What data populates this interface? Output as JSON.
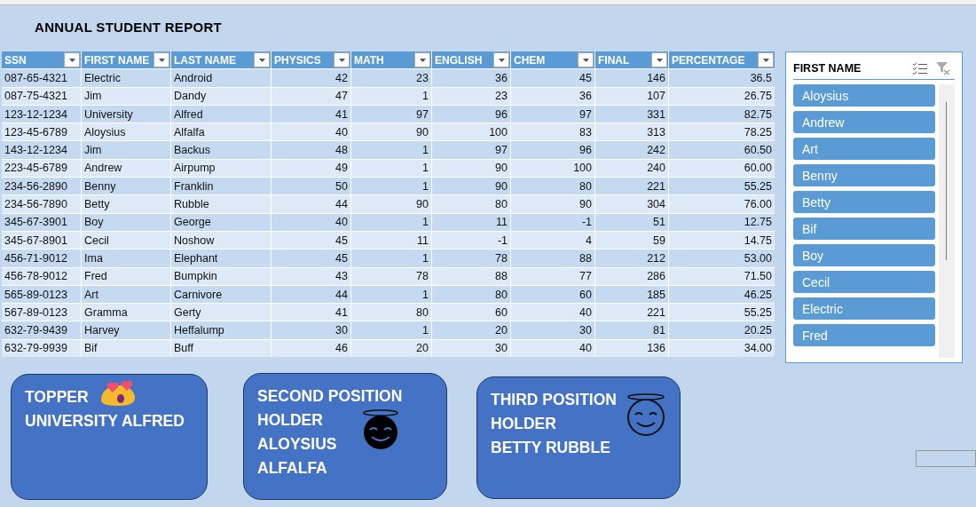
{
  "title": "ANNUAL STUDENT REPORT",
  "table": {
    "columns": [
      "SSN",
      "FIRST NAME",
      "LAST NAME",
      "PHYSICS",
      "MATH",
      "ENGLISH",
      "CHEM",
      "FINAL",
      "PERCENTAGE"
    ],
    "rows": [
      [
        "087-65-4321",
        "Electric",
        "Android",
        "42",
        "23",
        "36",
        "45",
        "146",
        "36.5"
      ],
      [
        "087-75-4321",
        "Jim",
        "Dandy",
        "47",
        "1",
        "23",
        "36",
        "107",
        "26.75"
      ],
      [
        "123-12-1234",
        "University",
        "Alfred",
        "41",
        "97",
        "96",
        "97",
        "331",
        "82.75"
      ],
      [
        "123-45-6789",
        "Aloysius",
        "Alfalfa",
        "40",
        "90",
        "100",
        "83",
        "313",
        "78.25"
      ],
      [
        "143-12-1234",
        "Jim",
        "Backus",
        "48",
        "1",
        "97",
        "96",
        "242",
        "60.50"
      ],
      [
        "223-45-6789",
        "Andrew",
        "Airpump",
        "49",
        "1",
        "90",
        "100",
        "240",
        "60.00"
      ],
      [
        "234-56-2890",
        "Benny",
        "Franklin",
        "50",
        "1",
        "90",
        "80",
        "221",
        "55.25"
      ],
      [
        "234-56-7890",
        "Betty",
        "Rubble",
        "44",
        "90",
        "80",
        "90",
        "304",
        "76.00"
      ],
      [
        "345-67-3901",
        "Boy",
        "George",
        "40",
        "1",
        "11",
        "-1",
        "51",
        "12.75"
      ],
      [
        "345-67-8901",
        "Cecil",
        "Noshow",
        "45",
        "11",
        "-1",
        "4",
        "59",
        "14.75"
      ],
      [
        "456-71-9012",
        "Ima",
        "Elephant",
        "45",
        "1",
        "78",
        "88",
        "212",
        "53.00"
      ],
      [
        "456-78-9012",
        "Fred",
        "Bumpkin",
        "43",
        "78",
        "88",
        "77",
        "286",
        "71.50"
      ],
      [
        "565-89-0123",
        "Art",
        "Carnivore",
        "44",
        "1",
        "80",
        "60",
        "185",
        "46.25"
      ],
      [
        "567-89-0123",
        "Gramma",
        "Gerty",
        "41",
        "80",
        "60",
        "40",
        "221",
        "55.25"
      ],
      [
        "632-79-9439",
        "Harvey",
        "Heffalump",
        "30",
        "1",
        "20",
        "30",
        "81",
        "20.25"
      ],
      [
        "632-79-9939",
        "Bif",
        "Buff",
        "46",
        "20",
        "30",
        "40",
        "136",
        "34.00"
      ]
    ]
  },
  "slicer": {
    "title": "FIRST NAME",
    "items": [
      {
        "label": "Aloysius",
        "selected": true
      },
      {
        "label": "Andrew",
        "selected": true
      },
      {
        "label": "Art",
        "selected": true
      },
      {
        "label": "Benny",
        "selected": true
      },
      {
        "label": "Betty",
        "selected": true
      },
      {
        "label": "Bif",
        "selected": true
      },
      {
        "label": "Boy",
        "selected": true
      },
      {
        "label": "Cecil",
        "selected": true
      },
      {
        "label": "Electric",
        "selected": true
      },
      {
        "label": "Fred",
        "selected": true
      }
    ]
  },
  "cards": [
    {
      "lines": [
        "TOPPER",
        "UNIVERSITY ALFRED"
      ]
    },
    {
      "lines": [
        "SECOND POSITION",
        "HOLDER",
        "ALOYSIUS",
        "ALFALFA"
      ]
    },
    {
      "lines": [
        "THIRD POSITION",
        "HOLDER",
        "BETTY RUBBLE"
      ]
    }
  ]
}
